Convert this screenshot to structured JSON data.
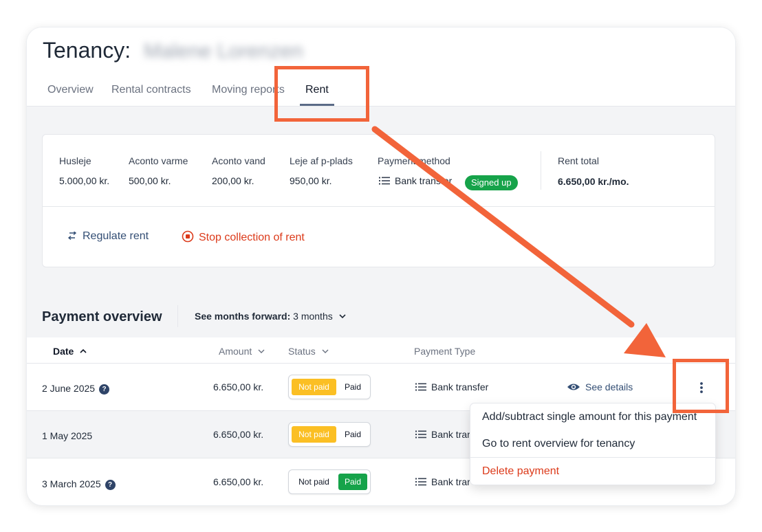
{
  "header": {
    "title": "Tenancy:",
    "tenant_name_blurred": "Malene Lorenzen",
    "tabs": [
      {
        "label": "Overview"
      },
      {
        "label": "Rental contracts"
      },
      {
        "label": "Moving reports"
      },
      {
        "label": "Rent"
      }
    ],
    "active_tab": "Rent"
  },
  "summary": {
    "items": [
      {
        "label": "Husleje",
        "value": "5.000,00 kr."
      },
      {
        "label": "Aconto varme",
        "value": "500,00 kr."
      },
      {
        "label": "Aconto vand",
        "value": "200,00 kr."
      },
      {
        "label": "Leje af p-plads",
        "value": "950,00 kr."
      }
    ],
    "payment_method_label": "Payment method",
    "payment_method_value": "Bank transfer",
    "payment_method_icon": "list-icon",
    "signed_up_badge": "Signed up",
    "rent_total_label": "Rent total",
    "rent_total_value": "6.650,00 kr./mo.",
    "actions": {
      "regulate": "Regulate rent",
      "regulate_icon": "swap-arrows-icon",
      "stop": "Stop collection of rent",
      "stop_icon": "stop-circle-icon"
    }
  },
  "payment_overview": {
    "title": "Payment overview",
    "months_label": "See months forward:",
    "months_value": "3 months",
    "columns": {
      "date": "Date",
      "amount": "Amount",
      "status": "Status",
      "payment_type": "Payment Type"
    },
    "rows": [
      {
        "date": "2 June 2025",
        "has_help": true,
        "amount": "6.650,00 kr.",
        "status": "Not paid",
        "payment_type": "Bank transfer",
        "details": "See details"
      },
      {
        "date": "1 May 2025",
        "has_help": false,
        "amount": "6.650,00 kr.",
        "status": "Not paid",
        "payment_type": "Bank trar"
      },
      {
        "date": "3 March 2025",
        "has_help": true,
        "amount": "6.650,00 kr.",
        "status": "Paid",
        "payment_type": "Bank trar"
      }
    ],
    "status_labels": {
      "not_paid": "Not paid",
      "paid": "Paid"
    },
    "help_glyph": "?"
  },
  "context_menu": {
    "items": [
      {
        "label": "Add/subtract single amount for this payment"
      },
      {
        "label": "Go to rent overview for tenancy"
      },
      {
        "label": "Delete payment"
      }
    ]
  },
  "colors": {
    "annotation": "#f2643a",
    "accent_blue": "#334e74",
    "danger": "#dc3a1a",
    "success": "#16a34a",
    "warning": "#fbbf24"
  }
}
